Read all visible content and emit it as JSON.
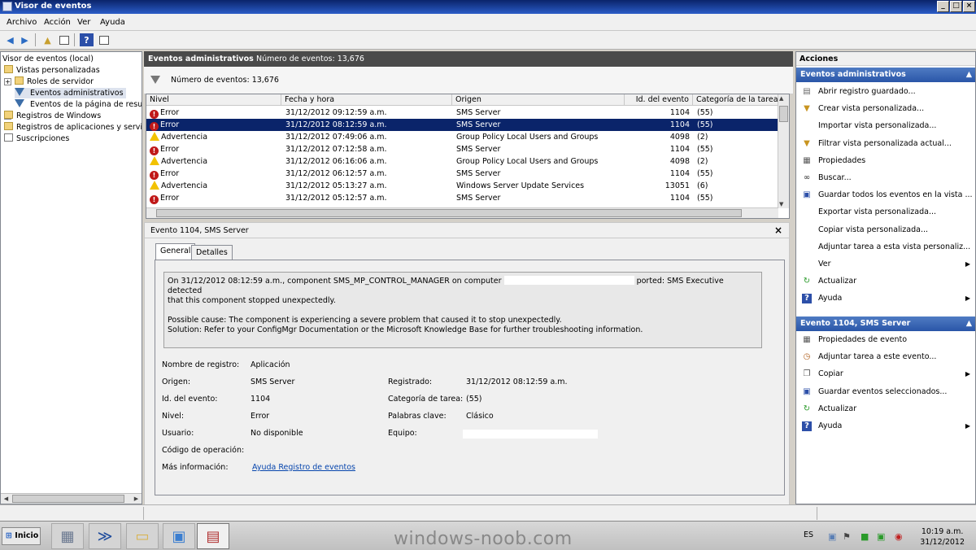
{
  "window": {
    "title": "Visor de eventos"
  },
  "menu": [
    "Archivo",
    "Acción",
    "Ver",
    "Ayuda"
  ],
  "tree": {
    "items": [
      {
        "label": "Visor de eventos (local)",
        "icon": "computer-icon"
      },
      {
        "label": "Vistas personalizadas",
        "icon": "folder-icon"
      },
      {
        "label": "Roles de servidor",
        "icon": "folder-icon"
      },
      {
        "label": "Eventos administrativos",
        "icon": "filter-icon"
      },
      {
        "label": "Eventos de la página de resumen",
        "icon": "filter-icon"
      },
      {
        "label": "Registros de Windows",
        "icon": "folder-icon"
      },
      {
        "label": "Registros de aplicaciones y servicios",
        "icon": "folder-icon"
      },
      {
        "label": "Suscripciones",
        "icon": "document-icon"
      }
    ]
  },
  "center": {
    "title": "Eventos administrativos",
    "count_label": "Número de eventos: 13,676",
    "filter_count": "Número de eventos: 13,676"
  },
  "table": {
    "columns": [
      "Nivel",
      "Fecha y hora",
      "Origen",
      "Id. del evento",
      "Categoría de la tarea"
    ],
    "rows": [
      {
        "level": "Error",
        "date": "31/12/2012 09:12:59 a.m.",
        "source": "SMS Server",
        "id": "1104",
        "category": "(55)"
      },
      {
        "level": "Error",
        "date": "31/12/2012 08:12:59 a.m.",
        "source": "SMS Server",
        "id": "1104",
        "category": "(55)"
      },
      {
        "level": "Advertencia",
        "date": "31/12/2012 07:49:06 a.m.",
        "source": "Group Policy Local Users and Groups",
        "id": "4098",
        "category": "(2)"
      },
      {
        "level": "Error",
        "date": "31/12/2012 07:12:58 a.m.",
        "source": "SMS Server",
        "id": "1104",
        "category": "(55)"
      },
      {
        "level": "Advertencia",
        "date": "31/12/2012 06:16:06 a.m.",
        "source": "Group Policy Local Users and Groups",
        "id": "4098",
        "category": "(2)"
      },
      {
        "level": "Error",
        "date": "31/12/2012 06:12:57 a.m.",
        "source": "SMS Server",
        "id": "1104",
        "category": "(55)"
      },
      {
        "level": "Advertencia",
        "date": "31/12/2012 05:13:27 a.m.",
        "source": "Windows Server Update Services",
        "id": "13051",
        "category": "(6)"
      },
      {
        "level": "Error",
        "date": "31/12/2012 05:12:57 a.m.",
        "source": "SMS Server",
        "id": "1104",
        "category": "(55)"
      }
    ]
  },
  "detail": {
    "title": "Evento 1104, SMS Server",
    "tabs": [
      "General",
      "Detalles"
    ],
    "message_line1a": "On 31/12/2012 08:12:59 a.m., component SMS_MP_CONTROL_MANAGER on computer",
    "message_line1b": "ported:  SMS Executive detected",
    "message_line2": "that this component stopped unexpectedly.",
    "message_line3": "Possible cause: The component is experiencing a severe problem that caused it to stop unexpectedly.",
    "message_line4": "Solution: Refer to your ConfigMgr Documentation or the Microsoft Knowledge Base for further troubleshooting information.",
    "fields": {
      "log_name_label": "Nombre de registro:",
      "log_name": "Aplicación",
      "source_label": "Origen:",
      "source": "SMS Server",
      "logged_label": "Registrado:",
      "logged": "31/12/2012 08:12:59 a.m.",
      "event_id_label": "Id. del evento:",
      "event_id": "1104",
      "task_category_label": "Categoría de tarea:",
      "task_category": "(55)",
      "level_label": "Nivel:",
      "level": "Error",
      "keywords_label": "Palabras clave:",
      "keywords": "Clásico",
      "user_label": "Usuario:",
      "user": "No disponible",
      "computer_label": "Equipo:",
      "opcode_label": "Código de operación:",
      "more_info_label": "Más información:",
      "more_info_link": "Ayuda Registro de eventos"
    }
  },
  "actions": {
    "header": "Acciones",
    "section1": "Eventos administrativos",
    "section1_items": [
      {
        "label": "Abrir registro guardado...",
        "icon": "open-icon"
      },
      {
        "label": "Crear vista personalizada...",
        "icon": "filter-icon"
      },
      {
        "label": "Importar vista personalizada...",
        "icon": "blank-icon"
      },
      {
        "label": "Filtrar vista personalizada actual...",
        "icon": "filter-icon"
      },
      {
        "label": "Propiedades",
        "icon": "properties-icon"
      },
      {
        "label": "Buscar...",
        "icon": "binoculars-icon"
      },
      {
        "label": "Guardar todos los eventos en la vista ...",
        "icon": "save-icon"
      },
      {
        "label": "Exportar vista personalizada...",
        "icon": "blank-icon"
      },
      {
        "label": "Copiar vista personalizada...",
        "icon": "blank-icon"
      },
      {
        "label": "Adjuntar tarea a esta vista personaliz...",
        "icon": "blank-icon"
      },
      {
        "label": "Ver",
        "icon": "blank-icon",
        "submenu": true
      },
      {
        "label": "Actualizar",
        "icon": "refresh-icon"
      },
      {
        "label": "Ayuda",
        "icon": "help-icon",
        "submenu": true
      }
    ],
    "section2": "Evento 1104, SMS Server",
    "section2_items": [
      {
        "label": "Propiedades de evento",
        "icon": "properties-icon"
      },
      {
        "label": "Adjuntar tarea a este evento...",
        "icon": "task-icon"
      },
      {
        "label": "Copiar",
        "icon": "copy-icon",
        "submenu": true
      },
      {
        "label": "Guardar eventos seleccionados...",
        "icon": "save-icon"
      },
      {
        "label": "Actualizar",
        "icon": "refresh-icon"
      },
      {
        "label": "Ayuda",
        "icon": "help-icon",
        "submenu": true
      }
    ]
  },
  "taskbar": {
    "start_label": "Inicio",
    "watermark": "windows-noob.com",
    "lang": "ES",
    "time": "10:19 a.m.",
    "date": "31/12/2012"
  },
  "colors": {
    "error": "#c01818",
    "warning": "#f2c200",
    "selection": "#0a246a",
    "section_header": "#2a56a8"
  }
}
